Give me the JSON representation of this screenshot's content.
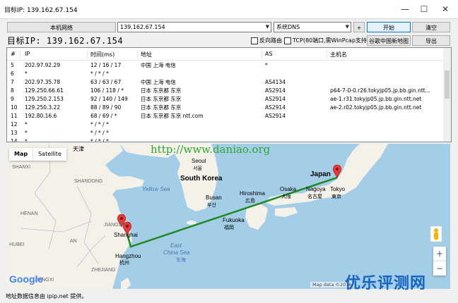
{
  "window": {
    "title": "目标IP: 139.162.67.154",
    "minimize_glyph": "—",
    "maximize_glyph": "☐",
    "close_glyph": "✕"
  },
  "toolbar": {
    "local_network_label": "本机网络",
    "target_value": "139.162.67.154",
    "dns_value": "系统DNS",
    "plus_label": "+",
    "start_label": "开始",
    "clear_label": "清空"
  },
  "header": {
    "big_title": "目标IP: 139.162.67.154",
    "reverse_route_label": "反向路由",
    "tcp_label": "TCP(80端口,需WinPcap支持)",
    "google_map_label": "谷歌中国新地图",
    "export_label": "导出"
  },
  "table": {
    "headers": [
      "#",
      "IP",
      "时间(ms)",
      "地址",
      "AS",
      "主机名"
    ],
    "rows": [
      [
        "5",
        "202.97.92.29",
        "12 / 16 / 17",
        "中国 上海 电信",
        "*",
        ""
      ],
      [
        "6",
        "*",
        "* / * / *",
        "",
        "",
        ""
      ],
      [
        "7",
        "202.97.35.78",
        "63 / 63 / 67",
        "中国 上海 电信",
        "AS4134",
        ""
      ],
      [
        "8",
        "129.250.66.61",
        "106 / 118 / *",
        "日本 东京都 东京",
        "AS2914",
        "p64-7-0-0.r26.tokyjp05.jp.bb.gin.ntt..."
      ],
      [
        "9",
        "129.250.2.153",
        "92 / 140 / 149",
        "日本 东京都 东京",
        "AS2914",
        "ae-1.r31.tokyjp05.jp.bb.gin.ntt.net"
      ],
      [
        "10",
        "129.250.3.22",
        "88 / 89 / 90",
        "日本 东京都 东京",
        "AS2914",
        "ae-2.r02.tokyjp05.jp.bb.gin.ntt.net"
      ],
      [
        "11",
        "192.80.16.6",
        "68 / 69 / *",
        "日本 东京都 东京 ntt.com",
        "AS2914",
        ""
      ],
      [
        "12",
        "*",
        "* / * / *",
        "",
        "",
        ""
      ],
      [
        "13",
        "*",
        "* / * / *",
        "",
        "",
        ""
      ],
      [
        "14",
        "*",
        "* / * / *",
        "",
        "",
        ""
      ]
    ]
  },
  "map": {
    "tab_map": "Map",
    "tab_satellite": "Satellite",
    "watermark": "http://www.daniao.org",
    "google": "Google",
    "map_data": "Map data ©2016",
    "zoom_in": "+",
    "zoom_out": "−",
    "labels": {
      "tianjin": "天津",
      "shanxi": "SHANXI",
      "shandong": "SHANDONG",
      "henan": "HENAN",
      "jiangsu": "JIANGSU",
      "hubei": "HUBEI",
      "anhui": "AN",
      "hangzhou": "Hangzhou",
      "hangzhou_cn": "杭州",
      "zhejiang": "ZHEJIANG",
      "jiangxi": "JIANGXI",
      "shanghai": "Shanghai",
      "shanghai_cn": "上海",
      "yellow_sea": "Yellow Sea",
      "seoul": "Seoul",
      "seoul_cn": "서울",
      "south_korea": "South Korea",
      "busan": "Busan",
      "busan_cn": "부산",
      "hiroshima": "Hiroshima",
      "hiroshima_cn": "広島",
      "osaka": "Osaka",
      "osaka_cn": "大阪",
      "nagoya": "Nagoya",
      "nagoya_cn": "名古屋",
      "tokyo": "Tokyo",
      "tokyo_cn": "東京",
      "japan": "Japan",
      "fukuoka": "Fukuoka",
      "fukuoka_cn": "福岡",
      "east_china_sea": "East",
      "east_china_sea2": "China Sea",
      "east_china_sea_cn": "东海"
    }
  },
  "status": {
    "text": "地址数据信息由 ipip.net 提供。"
  },
  "brand": {
    "text": "优乐评测网"
  },
  "colors": {
    "route_line": "#1f8a1f",
    "pin": "#e53935",
    "land": "#f4f1e9",
    "sea": "#a4cde8",
    "brand": "#1565c0",
    "watermark": "#2fa82f"
  }
}
